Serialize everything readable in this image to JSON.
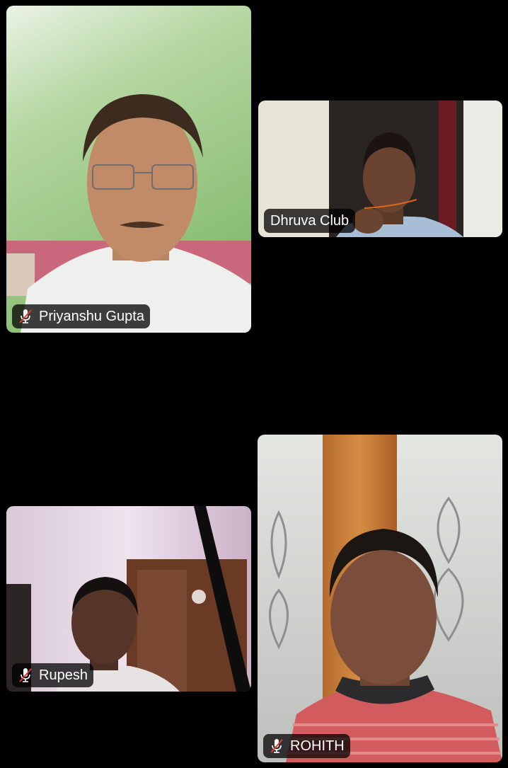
{
  "participants": [
    {
      "name": "Priyanshu Gupta",
      "muted": true,
      "mic_icon": "mic-muted-icon"
    },
    {
      "name": "Dhruva Club",
      "muted": false
    },
    {
      "name": "Rupesh",
      "muted": true,
      "mic_icon": "mic-muted-icon"
    },
    {
      "name": "ROHITH",
      "muted": true,
      "mic_icon": "mic-muted-icon"
    }
  ],
  "colors": {
    "background": "#000000",
    "tag_background": "rgba(0,0,0,0.75)",
    "mute_slash": "#e53935"
  }
}
